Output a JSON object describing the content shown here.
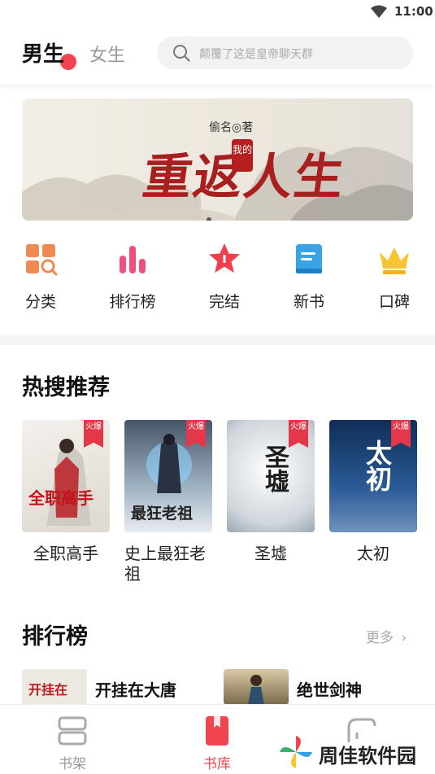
{
  "status_bar": {
    "time": "11:00"
  },
  "header": {
    "tab_male": "男生",
    "tab_female": "女生",
    "search_placeholder": "颠覆了这是皇帝聊天群"
  },
  "banner": {
    "author": "偷名◎著",
    "title": "重返人生",
    "seal": "我的",
    "active_slide": 1
  },
  "nav": [
    {
      "label": "分类",
      "icon": "category-icon"
    },
    {
      "label": "排行榜",
      "icon": "ranking-icon"
    },
    {
      "label": "完结",
      "icon": "star-icon"
    },
    {
      "label": "新书",
      "icon": "new-book-icon"
    },
    {
      "label": "口碑",
      "icon": "crown-icon"
    }
  ],
  "hot": {
    "title": "热搜推荐",
    "books": [
      {
        "name": "全职高手",
        "cover_text": "全职高手",
        "badge": "火爆"
      },
      {
        "name": "史上最狂老祖",
        "cover_text": "最狂老祖",
        "badge": "火爆"
      },
      {
        "name": "圣墟",
        "cover_text": "圣墟",
        "badge": "火爆"
      },
      {
        "name": "太初",
        "cover_text": "太初",
        "badge": "火爆"
      }
    ]
  },
  "ranking": {
    "title": "排行榜",
    "more": "更多",
    "items": [
      {
        "name": "开挂在大唐",
        "cover_text": "开挂在"
      },
      {
        "name": "绝世剑神"
      }
    ]
  },
  "bottom_nav": [
    {
      "label": "书架",
      "icon": "bookshelf-icon"
    },
    {
      "label": "书库",
      "icon": "library-icon"
    },
    {
      "label": "",
      "icon": "discover-icon"
    }
  ],
  "watermark": {
    "text": "周佳软件园"
  },
  "colors": {
    "accent": "#f2444f",
    "badge": "#e4384a"
  }
}
